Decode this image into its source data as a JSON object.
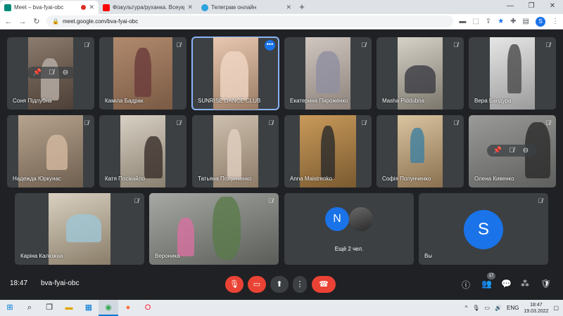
{
  "browser": {
    "tabs": [
      {
        "title": "Meet – bva-fyai-obc",
        "favicon_color": "#00897b",
        "active": true,
        "recording": true
      },
      {
        "title": "Фізкультура/руханка. Всеукраїн",
        "favicon_color": "#ff0000",
        "active": false
      },
      {
        "title": "Телеграм онлайн",
        "favicon_color": "#2aa3de",
        "active": false
      }
    ],
    "new_tab": "+",
    "url": "meet.google.com/bva-fyai-obc",
    "profile_initial": "S"
  },
  "meet": {
    "tiles": [
      {
        "name": "Соня Підлубна",
        "muted": true
      },
      {
        "name": "Каміла Бадрак",
        "muted": true
      },
      {
        "name": "SUNRISE DANCE CLUB",
        "muted": false,
        "speaking": true,
        "more": "•••"
      },
      {
        "name": "Екатерина Пироженко",
        "muted": true
      },
      {
        "name": "Masha Piddubna",
        "muted": true
      },
      {
        "name": "Вера Бандура",
        "muted": true
      },
      {
        "name": "Надежда Юркунас",
        "muted": true
      },
      {
        "name": "Катя Посікайло",
        "muted": true
      },
      {
        "name": "Татьяна Полунченко",
        "muted": true
      },
      {
        "name": "Anna Maistrenko",
        "muted": true
      },
      {
        "name": "Софія Полунченко",
        "muted": true
      },
      {
        "name": "Олена Кивенко",
        "muted": true
      },
      {
        "name": "Каріна Калюжна",
        "muted": true
      },
      {
        "name": "Вероника",
        "muted": true
      }
    ],
    "others": {
      "label": "Ещё 2 чел.",
      "initial": "N",
      "initial_color": "#1a73e8"
    },
    "self": {
      "name": "Вы",
      "initial": "S",
      "initial_color": "#1a73e8"
    }
  },
  "bottom_bar": {
    "time": "18:47",
    "meeting_code": "bva-fyai-obc",
    "participant_count": "17"
  },
  "taskbar": {
    "lang": "ENG",
    "clock_time": "18:47",
    "clock_date": "19.03.2022"
  },
  "colors": {
    "meet_bg": "#202124",
    "tile_bg": "#3c4043",
    "accent": "#1a73e8",
    "danger": "#ea4335"
  }
}
